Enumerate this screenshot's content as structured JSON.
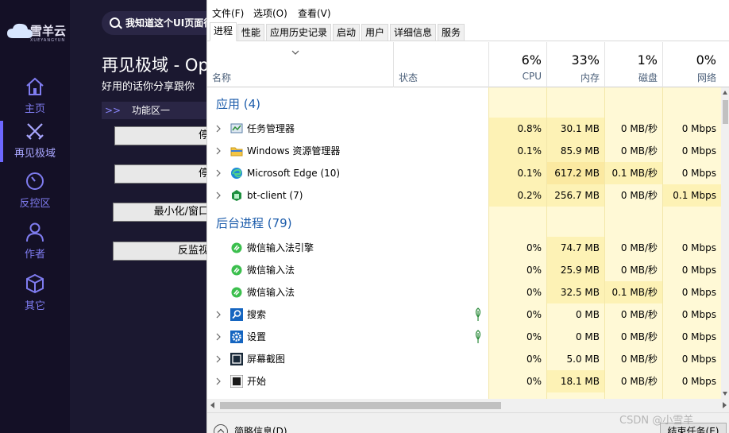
{
  "bg_app": {
    "logo_text": "雪羊云",
    "logo_sub": "XUEYANGYUN",
    "nav": [
      {
        "label": "主页",
        "icon": "home-icon"
      },
      {
        "label": "再见极域",
        "icon": "swords-icon"
      },
      {
        "label": "反控区",
        "icon": "timer-icon"
      },
      {
        "label": "作者",
        "icon": "user-icon"
      },
      {
        "label": "其它",
        "icon": "cube-icon"
      }
    ],
    "search_text": "我知道这个UI页面很",
    "title": "再见极域 - Op",
    "subtitle": "好用的话你分享跟你",
    "section_arrows": ">>",
    "section_label": "功能区一",
    "buttons": [
      "停",
      "停",
      "最小化/窗口",
      "反监视"
    ]
  },
  "taskmgr": {
    "menu": [
      "文件(F)",
      "选项(O)",
      "查看(V)"
    ],
    "tabs": [
      "进程",
      "性能",
      "应用历史记录",
      "启动",
      "用户",
      "详细信息",
      "服务"
    ],
    "columns": {
      "name": "名称",
      "status": "状态",
      "cpu": {
        "pct": "6%",
        "label": "CPU"
      },
      "mem": {
        "pct": "33%",
        "label": "内存"
      },
      "disk": {
        "pct": "1%",
        "label": "磁盘"
      },
      "net": {
        "pct": "0%",
        "label": "网络"
      }
    },
    "groups": {
      "apps": "应用 (4)",
      "background": "后台进程 (79)"
    },
    "apps": [
      {
        "name": "任务管理器",
        "icon": "task-manager-icon",
        "cpu": "0.8%",
        "mem": "30.1 MB",
        "disk": "0 MB/秒",
        "net": "0 Mbps"
      },
      {
        "name": "Windows 资源管理器",
        "icon": "folder-icon",
        "cpu": "0.1%",
        "mem": "85.9 MB",
        "disk": "0 MB/秒",
        "net": "0 Mbps"
      },
      {
        "name": "Microsoft Edge (10)",
        "icon": "edge-icon",
        "cpu": "0.1%",
        "mem": "617.2 MB",
        "disk": "0.1 MB/秒",
        "net": "0 Mbps"
      },
      {
        "name": "bt-client (7)",
        "icon": "bt-client-icon",
        "cpu": "0.2%",
        "mem": "256.7 MB",
        "disk": "0 MB/秒",
        "net": "0.1 Mbps"
      }
    ],
    "background": [
      {
        "name": "微信输入法引擎",
        "icon": "wechat-ime-icon",
        "expandable": false,
        "leaf": false,
        "cpu": "0%",
        "mem": "74.7 MB",
        "disk": "0 MB/秒",
        "net": "0 Mbps"
      },
      {
        "name": "微信输入法",
        "icon": "wechat-ime-icon",
        "expandable": false,
        "leaf": false,
        "cpu": "0%",
        "mem": "25.9 MB",
        "disk": "0 MB/秒",
        "net": "0 Mbps"
      },
      {
        "name": "微信输入法",
        "icon": "wechat-ime-icon",
        "expandable": false,
        "leaf": false,
        "cpu": "0%",
        "mem": "32.5 MB",
        "disk": "0.1 MB/秒",
        "net": "0 Mbps"
      },
      {
        "name": "搜索",
        "icon": "search-app-icon",
        "expandable": true,
        "leaf": true,
        "cpu": "0%",
        "mem": "0 MB",
        "disk": "0 MB/秒",
        "net": "0 Mbps"
      },
      {
        "name": "设置",
        "icon": "settings-icon",
        "expandable": true,
        "leaf": true,
        "cpu": "0%",
        "mem": "0 MB",
        "disk": "0 MB/秒",
        "net": "0 Mbps"
      },
      {
        "name": "屏幕截图",
        "icon": "screenshot-icon",
        "expandable": true,
        "leaf": false,
        "cpu": "0%",
        "mem": "5.0 MB",
        "disk": "0 MB/秒",
        "net": "0 Mbps"
      },
      {
        "name": "开始",
        "icon": "start-icon",
        "expandable": true,
        "leaf": false,
        "cpu": "0%",
        "mem": "18.1 MB",
        "disk": "0 MB/秒",
        "net": "0 Mbps"
      }
    ],
    "footer_text": "简略信息(D)",
    "end_task": "结束任务(E)"
  },
  "watermark": "CSDN @小雪羊",
  "colors": {
    "bg_dark": "#1b1830",
    "accent_purple": "#7f7cf0",
    "heat_light": "#fff9d6",
    "heat_mid": "#fdf2b5",
    "group_blue": "#1c5cab"
  }
}
